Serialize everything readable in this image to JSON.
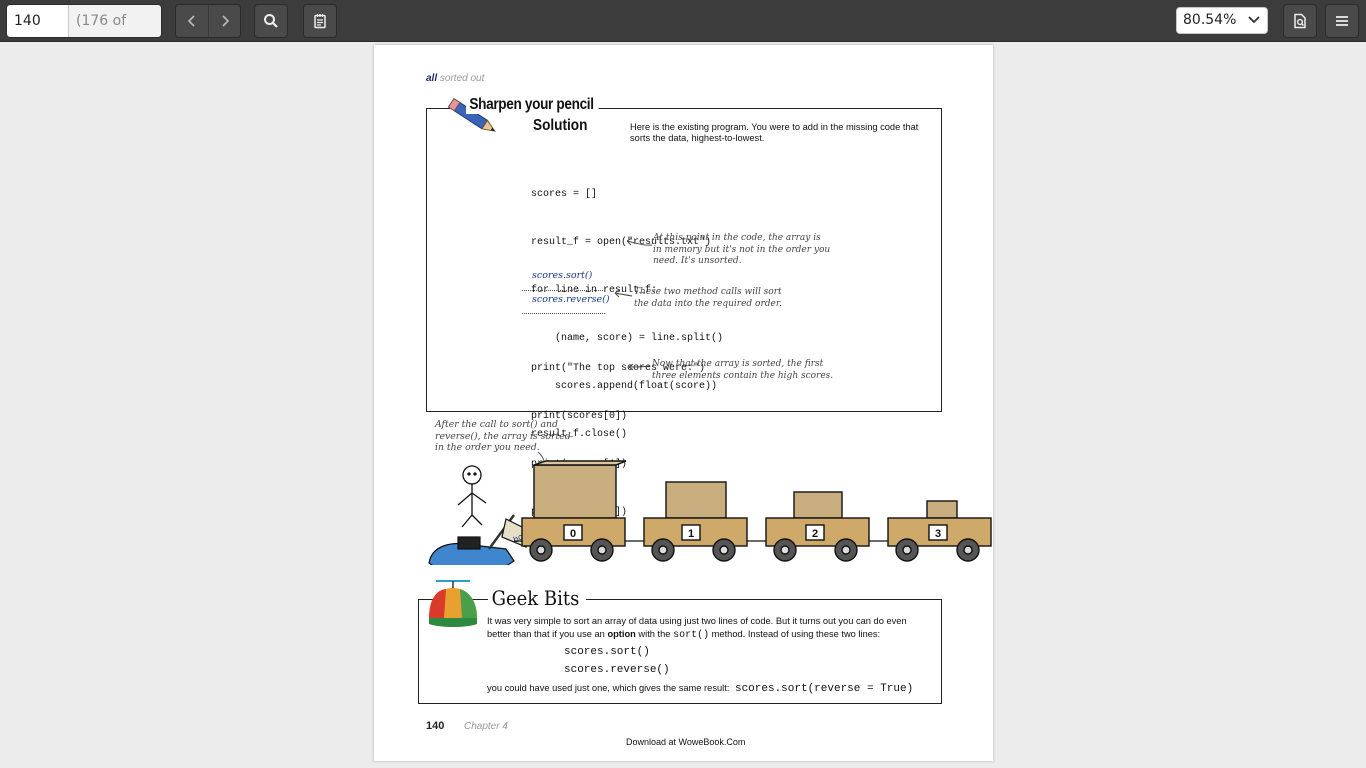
{
  "toolbar": {
    "page_number": "140",
    "page_count": "(176 of 442)",
    "zoom": "80.54%",
    "icons": [
      "chevron-left-icon",
      "chevron-right-icon",
      "search-icon",
      "annotations-icon",
      "chevron-down-icon",
      "sidebar-document-icon",
      "hamburger-menu-icon"
    ]
  },
  "page": {
    "running_head_bold": "all",
    "running_head": "sorted out",
    "sharpen": {
      "title": "Sharpen your pencil",
      "subtitle": "Solution",
      "intro": "Here is the existing program. You were to add in the missing code that sorts the data, highest-to-lowest.",
      "code_top": [
        "scores = []",
        "result_f = open(\"results.txt\")",
        "for line in result_f:",
        "    (name, score) = line.split()",
        "    scores.append(float(score))",
        "result_f.close()"
      ],
      "note_memory": [
        "At this point in the code, the array is",
        "in memory but it's not in the order you",
        "need. It's unsorted."
      ],
      "answer_1": "scores.sort()",
      "answer_2": "scores.reverse()",
      "note_sort": [
        "These two method calls will sort",
        "the data into the required order."
      ],
      "code_bottom": [
        "print(\"The top scores were:\")",
        "print(scores[0])",
        "print(scores[1])",
        "print(scores[2])"
      ],
      "note_scores": [
        "Now that the array is sorted, the first",
        "three elements contain the high scores."
      ]
    },
    "illustration": {
      "caption": [
        "After the call to sort() and",
        "reverse(), the array is sorted",
        "in the order you need."
      ],
      "scooter_label": "bor",
      "cart_indices": [
        "0",
        "1",
        "2",
        "3"
      ]
    },
    "geek": {
      "title": "Geek Bits",
      "text_1a": "It was very simple to sort an array of data using just two lines of code. But it turns out you can do even",
      "text_1b_pre": "better than that if you use an ",
      "text_1b_bold": "option",
      "text_1b_mid": " with the ",
      "text_1b_code": "sort()",
      "text_1b_post": " method. Instead of using these two lines:",
      "code_1": "scores.sort()",
      "code_2": "scores.reverse()",
      "text_2": "you could have used just one, which gives the same result:",
      "code_3": "scores.sort(reverse = True)"
    },
    "footer_page": "140",
    "footer_chapter": "Chapter 4",
    "footer_download": "Download at WoweBook.Com"
  }
}
